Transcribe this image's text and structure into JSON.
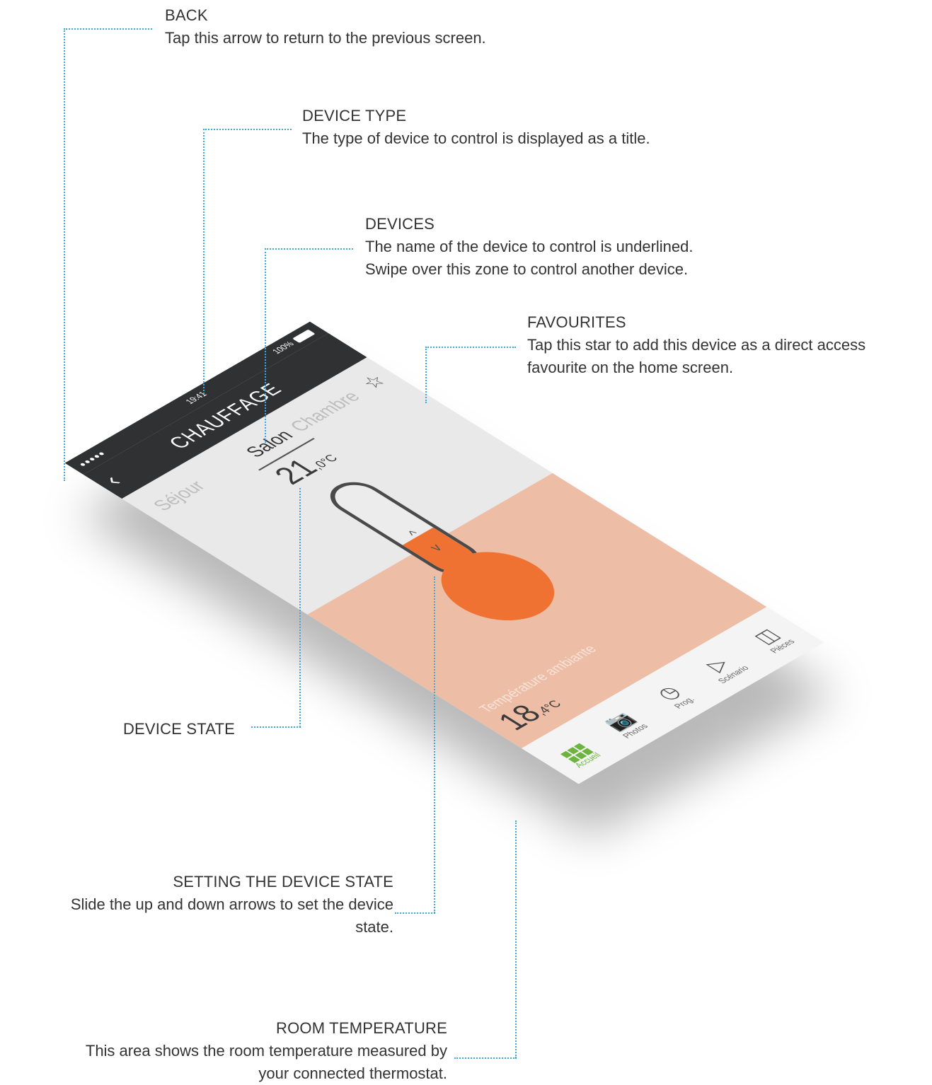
{
  "annotations": {
    "back": {
      "title": "BACK",
      "desc": "Tap this arrow to return to the previous screen."
    },
    "device_type": {
      "title": "DEVICE TYPE",
      "desc": "The type of device to control is displayed as a title."
    },
    "devices": {
      "title": "DEVICES",
      "desc1": "The name of the device to control is underlined.",
      "desc2": "Swipe over this zone to control another device."
    },
    "favourites": {
      "title": "FAVOURITES",
      "desc1": "Tap this star to add this device as a direct access",
      "desc2": "favourite on the home screen."
    },
    "device_state": {
      "title": "DEVICE STATE"
    },
    "setting_state": {
      "title": "SETTING THE DEVICE STATE",
      "desc1": "Slide the up and down arrows to set the device",
      "desc2": "state."
    },
    "room_temp": {
      "title": "ROOM TEMPERATURE",
      "desc1": "This area shows the room temperature measured by",
      "desc2": "your connected thermostat."
    }
  },
  "phone": {
    "status": {
      "signal": "●●●●● ",
      "time": "19:41",
      "battery": "100%"
    },
    "nav": {
      "back": "‹",
      "title": "CHAUFFAGE"
    },
    "devices": {
      "left": "Séjour",
      "center": "Salon",
      "right": "Chambre"
    },
    "setpoint": {
      "int": "21",
      "dec": ",0°C"
    },
    "favourite_icon": "☆",
    "thermo": {
      "up": "^",
      "down": "v",
      "fill_level": 0.4
    },
    "ambient": {
      "label": "Température ambiante",
      "int": "18",
      "dec": ",4°C"
    },
    "tabs": {
      "accueil": "Accueil",
      "photos": "Photos",
      "prog": "Prog.",
      "scenario": "Scénario",
      "pieces": "Pièces"
    }
  },
  "colors": {
    "accent_line": "#3ea8d8",
    "heating": "#f07232",
    "heating_bg": "#edbda6",
    "nav_bg": "#303132",
    "active_tab": "#6cb33f"
  }
}
